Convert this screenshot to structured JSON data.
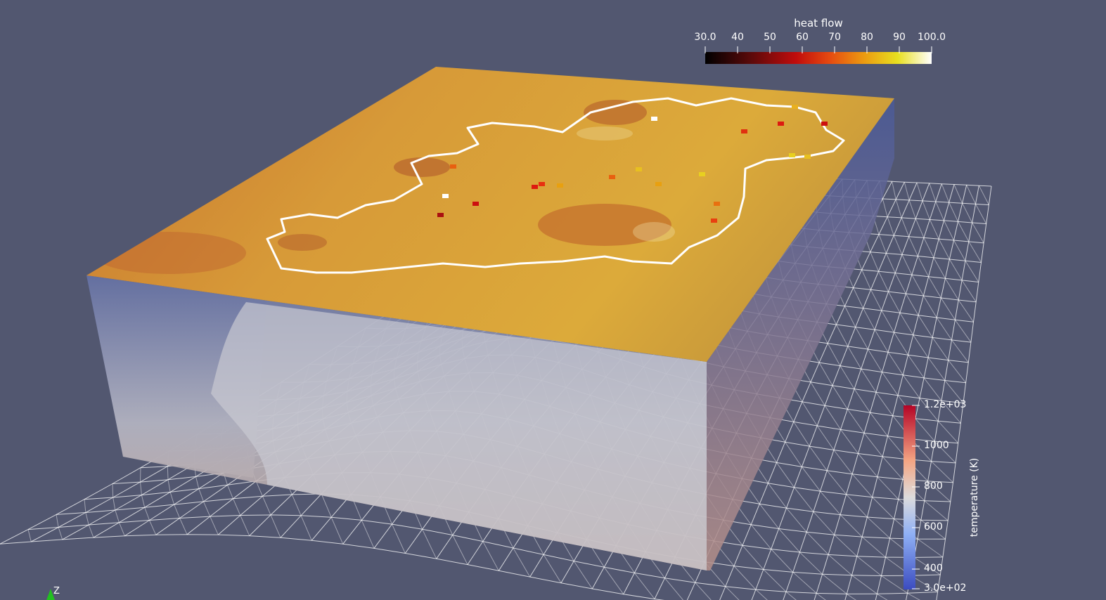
{
  "heat_flow_bar": {
    "title": "heat flow",
    "ticks": [
      "30.0",
      "40",
      "50",
      "60",
      "70",
      "80",
      "90",
      "100.0"
    ],
    "range": [
      30,
      100
    ],
    "colormap": "black-body"
  },
  "temperature_bar": {
    "title": "temperature (K)",
    "ticks": [
      "1.2e+03",
      "1000",
      "800",
      "600",
      "400",
      "3.0e+02"
    ],
    "range": [
      300,
      1200
    ],
    "colormap": "cool-to-warm"
  },
  "orientation_axis": {
    "label": "Z"
  },
  "colors": {
    "background": "#525770",
    "top_surface": "#d9a035",
    "coastline": "#ffffff",
    "wireframe": "#ffffff"
  }
}
